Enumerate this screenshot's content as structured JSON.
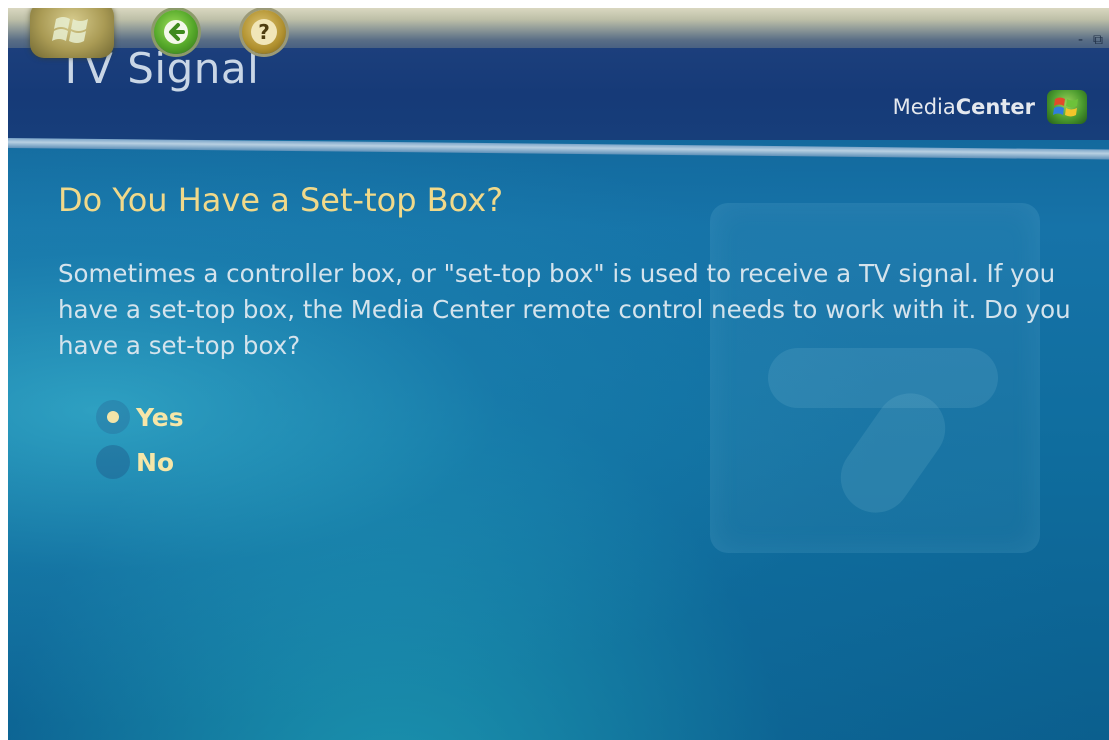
{
  "window": {
    "title": "TV Signal",
    "controls": [
      "-",
      "⧉"
    ]
  },
  "toolbar": {
    "start_icon": "windows-start-orb-icon",
    "back_icon": "back-arrow-icon",
    "help_label": "?"
  },
  "brand": {
    "name_regular": "Media",
    "name_bold": "Center",
    "logo_icon": "windows-flag-icon"
  },
  "main": {
    "question": "Do You Have a Set-top Box?",
    "description": "Sometimes a controller box, or \"set-top box\" is used to receive a TV signal. If you have a set-top box, the Media Center remote control needs to work with it. Do you have a set-top box?",
    "options": [
      {
        "label": "Yes",
        "selected": true
      },
      {
        "label": "No",
        "selected": false
      }
    ]
  },
  "colors": {
    "question_text": "#f0d98a",
    "option_text": "#f6e6a8",
    "body_text": "#d4e3ec",
    "background_blue": "#1673a8"
  }
}
